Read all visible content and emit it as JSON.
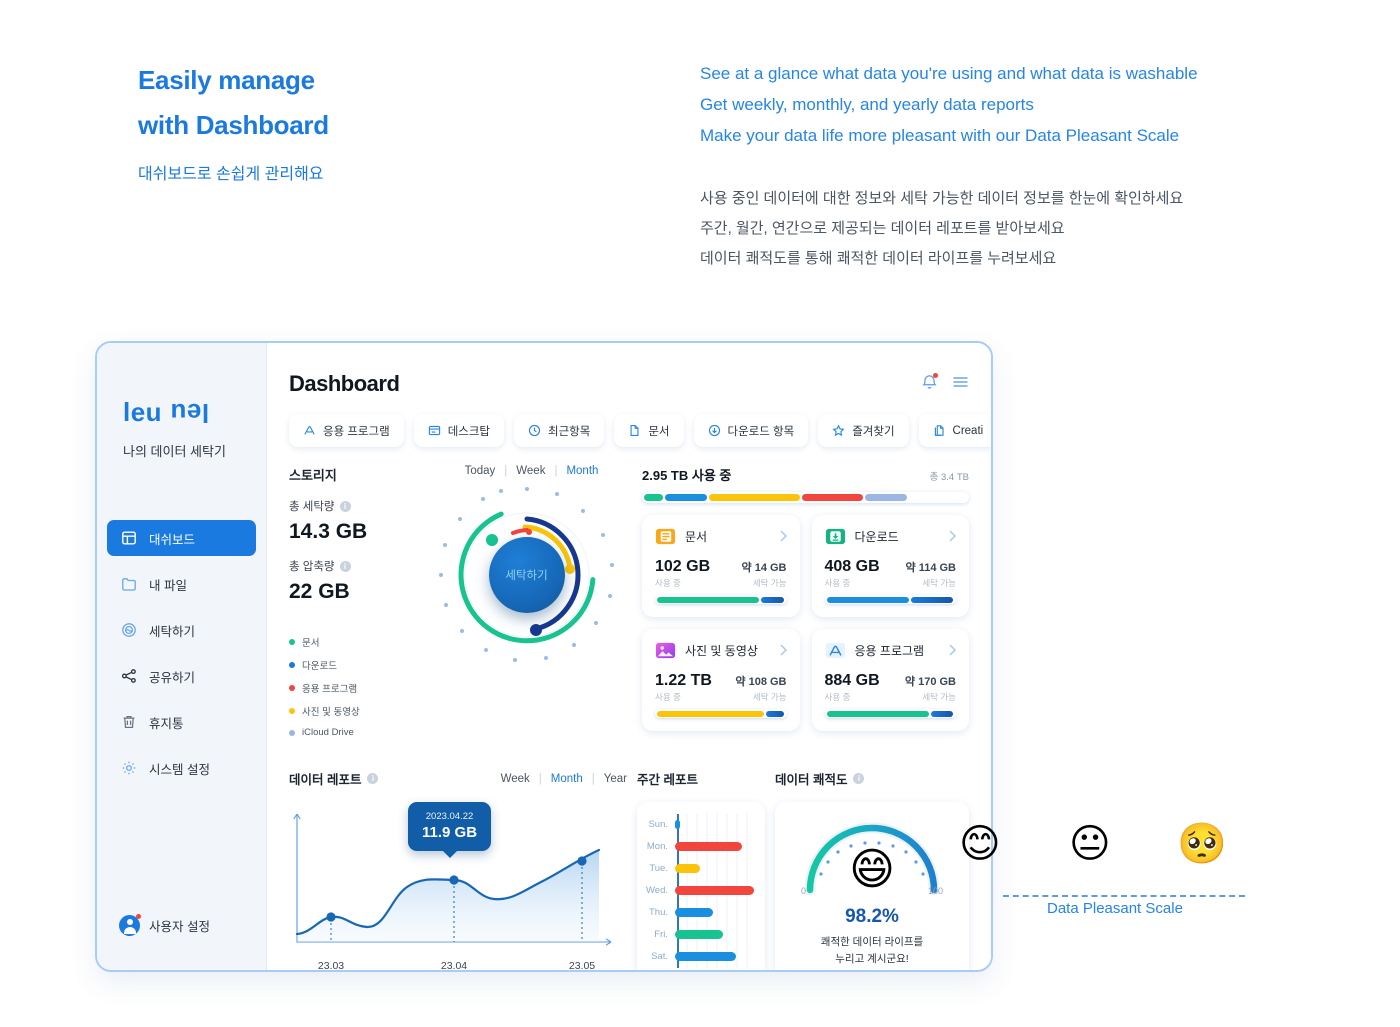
{
  "intro": {
    "headline_line1": "Easily manage",
    "headline_line2": "with Dashboard",
    "headline_kr": "대쉬보드로 손쉽게 관리해요",
    "en_lines": [
      "See at a glance what data you're using and what data is washable",
      "Get weekly, monthly, and yearly data reports",
      "Make your data life more pleasant with our Data Pleasant Scale"
    ],
    "kr_lines": [
      "사용 중인 데이터에 대한 정보와 세탁 가능한 데이터 정보를 한눈에 확인하세요",
      "주간, 월간, 연간으로 제공되는 데이터 레포트를 받아보세요",
      "데이터 쾌적도를 통해 쾌적한 데이터 라이프를 누려보세요"
    ],
    "accent_color": "#2585e8"
  },
  "sidebar": {
    "logo_a": "leu",
    "logo_b": "leu",
    "tagline": "나의 데이터 세탁기",
    "items": [
      {
        "label": "대쉬보드",
        "icon": "dashboard-icon",
        "active": true
      },
      {
        "label": "내 파일",
        "icon": "folder-icon",
        "active": false
      },
      {
        "label": "세탁하기",
        "icon": "wash-icon",
        "active": false
      },
      {
        "label": "공유하기",
        "icon": "share-icon",
        "active": false
      },
      {
        "label": "휴지통",
        "icon": "trash-icon",
        "active": false
      },
      {
        "label": "시스템 설정",
        "icon": "gear-icon",
        "active": false
      }
    ],
    "user_setting_label": "사용자 설정"
  },
  "header": {
    "title": "Dashboard",
    "bell_icon": "bell-icon",
    "menu_icon": "hamburger-menu-icon"
  },
  "tabs": [
    {
      "label": "응용 프로그램",
      "icon": "appstore-icon"
    },
    {
      "label": "데스크탑",
      "icon": "desktop-icon"
    },
    {
      "label": "최근항목",
      "icon": "clock-icon"
    },
    {
      "label": "문서",
      "icon": "document-icon"
    },
    {
      "label": "다운로드 항목",
      "icon": "download-icon"
    },
    {
      "label": "즐겨찾기",
      "icon": "star-icon"
    },
    {
      "label": "Creati",
      "icon": "copy-icon"
    }
  ],
  "storage": {
    "section_title": "스토리지",
    "total_wash_label": "총 세탁량",
    "total_wash_value": "14.3 GB",
    "total_compress_label": "총 압축량",
    "total_compress_value": "22 GB",
    "legend": [
      {
        "label": "문서",
        "color": "#17c38e"
      },
      {
        "label": "다운로드",
        "color": "#1a7ae0"
      },
      {
        "label": "응용 프로그램",
        "color": "#f2453d"
      },
      {
        "label": "사진 및 동영상",
        "color": "#fcc408"
      },
      {
        "label": "iCloud Drive",
        "color": "#9bb6e5"
      }
    ],
    "periods": [
      {
        "label": "Today",
        "active": false
      },
      {
        "label": "Week",
        "active": false
      },
      {
        "label": "Month",
        "active": true
      }
    ],
    "wash_button_label": "세탁하기"
  },
  "usage": {
    "used_label": "2.95 TB 사용 중",
    "total_label": "총 3.4 TB",
    "segments": [
      {
        "name": "문서",
        "color": "#17c38e",
        "pct": 6
      },
      {
        "name": "다운로드",
        "color": "#1a7ae0",
        "pct": 13
      },
      {
        "name": "사진 및 동영상",
        "color": "#fcc408",
        "pct": 28
      },
      {
        "name": "응용 프로그램",
        "color": "#f2453d",
        "pct": 19
      },
      {
        "name": "iCloud Drive",
        "color": "#9bb6e5",
        "pct": 13
      }
    ]
  },
  "cards": [
    {
      "name": "문서",
      "icon": "documents-folder-icon",
      "icon_color": "#f7a81b",
      "used": "102 GB",
      "free": "약 14 GB",
      "used_sub": "사용 중",
      "free_sub": "세탁 가능",
      "bar_color": "#17c38e",
      "bar_pct": 80
    },
    {
      "name": "다운로드",
      "icon": "download-box-icon",
      "icon_color": "#17b184",
      "used": "408 GB",
      "free": "약 114 GB",
      "used_sub": "사용 중",
      "free_sub": "세탁 가능",
      "bar_color": "#1a8fe0",
      "bar_pct": 65
    },
    {
      "name": "사진 및 동영상",
      "icon": "photos-icon",
      "icon_color": "#e2479e",
      "used": "1.22 TB",
      "free": "약 108 GB",
      "used_sub": "사용 중",
      "free_sub": "세탁 가능",
      "bar_color": "#fcc408",
      "bar_pct": 84
    },
    {
      "name": "응용 프로그램",
      "icon": "appstore-icon",
      "icon_color": "#1a7ae0",
      "used": "884 GB",
      "free": "약 170 GB",
      "used_sub": "사용 중",
      "free_sub": "세탁 가능",
      "bar_color": "#17c38e",
      "bar_pct": 80
    }
  ],
  "report": {
    "title": "데이터 레포트",
    "periods": [
      {
        "label": "Week",
        "active": false
      },
      {
        "label": "Month",
        "active": true
      },
      {
        "label": "Year",
        "active": false
      }
    ],
    "tooltip_date": "2023.04.22",
    "tooltip_value": "11.9 GB"
  },
  "weekly": {
    "title": "주간 레포트",
    "days": [
      {
        "label": "Sun.",
        "value": 6,
        "color": "#1a8fe0"
      },
      {
        "label": "Mon.",
        "value": 82,
        "color": "#f2453d"
      },
      {
        "label": "Tue.",
        "value": 30,
        "color": "#fcc408"
      },
      {
        "label": "Wed.",
        "value": 96,
        "color": "#f2453d"
      },
      {
        "label": "Thu.",
        "value": 46,
        "color": "#1a8fe0"
      },
      {
        "label": "Fri.",
        "value": 58,
        "color": "#17c38e"
      },
      {
        "label": "Sat.",
        "value": 74,
        "color": "#1a8fe0"
      }
    ]
  },
  "pleasant": {
    "title": "데이터 쾌적도",
    "emoji": "😄",
    "min": "0",
    "max": "100",
    "percent": "98.2%",
    "message_line1": "쾌적한 데이터 라이프를",
    "message_line2": "누리고 계시군요!"
  },
  "scale": {
    "caption": "Data Pleasant Scale",
    "emojis": [
      "😊",
      "😐",
      "🥺"
    ]
  },
  "chart_data": [
    {
      "type": "area",
      "title": "데이터 레포트",
      "x": [
        "23.03",
        "23.04",
        "23.05"
      ],
      "xlabel": "",
      "ylabel": "",
      "annotation": {
        "date": "2023.04.22",
        "value": "11.9 GB"
      },
      "points": [
        {
          "x": 0,
          "y": 8
        },
        {
          "x": 1,
          "y": 62
        },
        {
          "x": 2,
          "y": 78
        }
      ],
      "grid": false,
      "legend": "none",
      "line_color": "#1867b5"
    },
    {
      "type": "bar",
      "title": "주간 레포트",
      "orientation": "horizontal",
      "categories": [
        "Sun.",
        "Mon.",
        "Tue.",
        "Wed.",
        "Thu.",
        "Fri.",
        "Sat."
      ],
      "values": [
        6,
        82,
        30,
        96,
        46,
        58,
        74
      ],
      "colors": [
        "#1a8fe0",
        "#f2453d",
        "#fcc408",
        "#f2453d",
        "#1a8fe0",
        "#17c38e",
        "#1a8fe0"
      ],
      "xlabel": "",
      "ylabel": "",
      "grid": true,
      "legend": "none"
    },
    {
      "type": "pie",
      "title": "스토리지",
      "labels": [
        "문서",
        "다운로드",
        "사진 및 동영상",
        "응용 프로그램",
        "iCloud Drive"
      ],
      "values": [
        6,
        13,
        28,
        19,
        13
      ],
      "colors": [
        "#17c38e",
        "#1a7ae0",
        "#fcc408",
        "#f2453d",
        "#9bb6e5"
      ],
      "legend": "left"
    },
    {
      "type": "gauge",
      "title": "데이터 쾌적도",
      "value": 98.2,
      "ylim": [
        0,
        100
      ],
      "label": "98.2%"
    }
  ]
}
